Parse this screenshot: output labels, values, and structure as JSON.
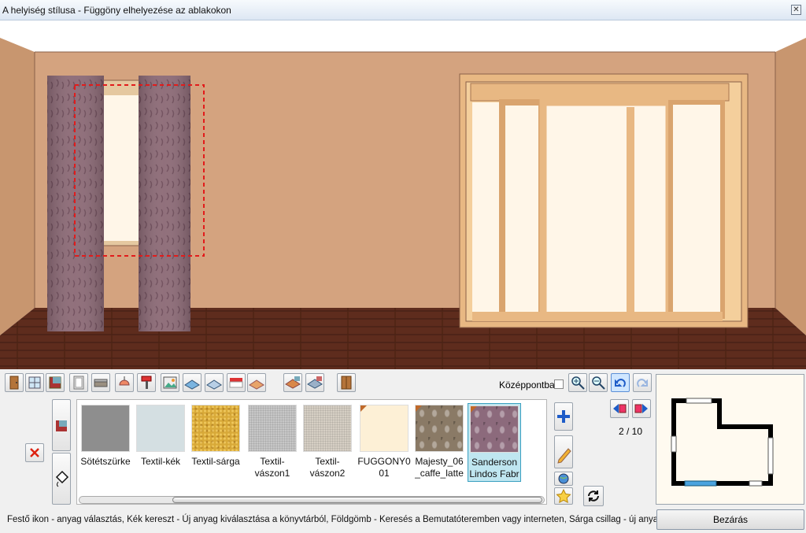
{
  "window": {
    "title": "A helyiség stílusa - Függöny elhelyezése az ablakokon",
    "close_glyph": "✕"
  },
  "toolbar": {
    "icons": [
      "door-icon",
      "window-icon",
      "wall-material-icon",
      "cabinet-icon",
      "sofa-icon",
      "lamp-icon",
      "paint-roller-icon",
      "picture-icon",
      "floor-tile-icon",
      "floor-pattern-icon",
      "awning-icon",
      "bed-icon",
      "brick-floor-icon",
      "tile-floor-icon",
      "wardrobe-icon"
    ],
    "center_label": "Középpontba",
    "zoom_in_icon": "zoom-in-icon",
    "zoom_out_icon": "zoom-out-icon",
    "undo_icon": "undo-icon",
    "redo_icon": "redo-icon"
  },
  "materials": {
    "items": [
      {
        "label": "Sötétszürke",
        "color": "#8e8e8e",
        "pattern": "solid",
        "corner": false
      },
      {
        "label": "Textil-kék",
        "color": "#d4dfe2",
        "pattern": "solid",
        "corner": false
      },
      {
        "label": "Textil-sárga",
        "color": "#d8a938",
        "pattern": "sand",
        "corner": false
      },
      {
        "label": "Textil-\nvászon1",
        "color": "#c7c7c7",
        "pattern": "canvas",
        "corner": false
      },
      {
        "label": "Textil-\nvászon2",
        "color": "#d6cfc4",
        "pattern": "canvas",
        "corner": false
      },
      {
        "label": "FUGGONY0\n01",
        "color": "#fdf0d6",
        "pattern": "solid",
        "corner": true
      },
      {
        "label": "Majesty_06\n_caffe_latte",
        "color": "#8a7a66",
        "pattern": "damask",
        "corner": true
      },
      {
        "label": "Sanderson\nLindos Fabr",
        "color": "#8c6a7c",
        "pattern": "damask",
        "corner": true,
        "selected": true
      }
    ]
  },
  "side_buttons": {
    "delete_icon": "red-x-icon",
    "curtain_icon": "curtain-icon",
    "paint_icon": "paint-bucket-icon",
    "add_icon": "blue-cross-icon",
    "edit_icon": "pencil-icon",
    "search_icon": "globe-icon",
    "new_icon": "yellow-star-icon",
    "refresh_icon": "refresh-icon",
    "prev_icon": "prev-page-icon",
    "next_icon": "next-page-icon"
  },
  "pager": {
    "text": "2 / 10"
  },
  "status": {
    "hint": "Festő ikon - anyag választás, Kék kereszt - Új anyag kiválasztása a könyvtárból, Földgömb - Keresés a Bemutatóteremben vagy interneten, Sárga csillag - új anyag"
  },
  "buttons": {
    "close_label": "Bezárás"
  },
  "colors": {
    "wall": "#d4a37f",
    "floor": "#5a2a1c",
    "ceiling": "#ffffff",
    "curtain": "#8a6a76",
    "frame": "#e7b882",
    "accent": "#3aa0c0"
  }
}
